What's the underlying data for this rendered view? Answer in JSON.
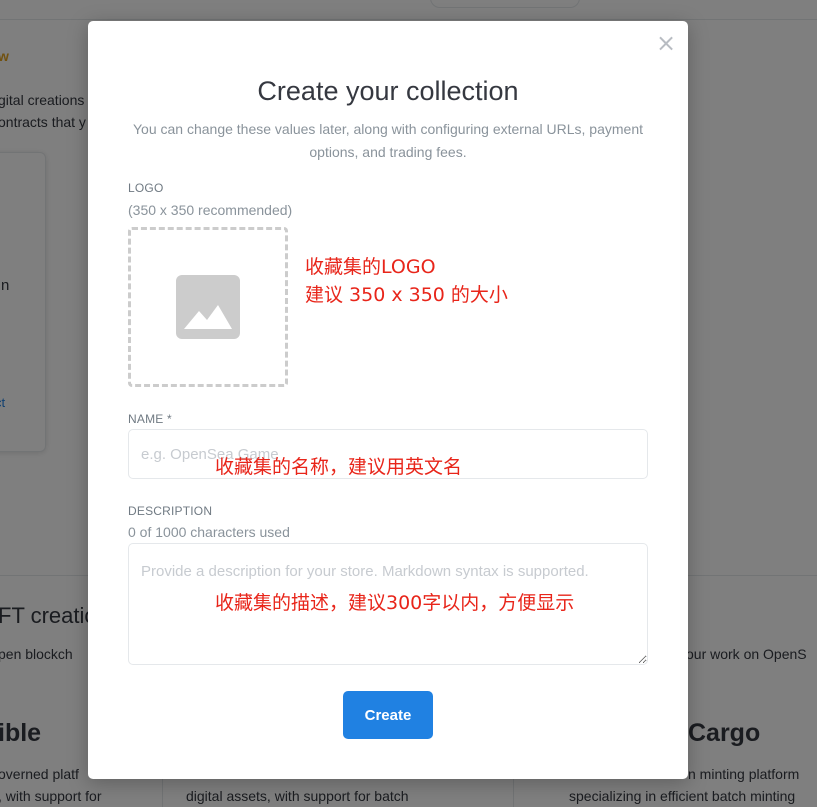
{
  "background": {
    "left_texts": {
      "line1": "w",
      "line2": "gital creations",
      "line3": "ontracts that y",
      "card_text1": "n",
      "card_link": "ct",
      "section_heading": "FT creatio",
      "section_sub": "pen blockch",
      "brand_left": "ible",
      "left_desc1": "overned platf",
      "left_desc2": ", with support for"
    },
    "middle_texts": {
      "desc": "digital assets, with support for batch"
    },
    "right_texts": {
      "sub": "our work on OpenS",
      "brand_right": "Cargo",
      "desc1": "n minting platform",
      "desc2": "specializing in efficient batch minting"
    }
  },
  "modal": {
    "close_symbol": "×",
    "title": "Create your collection",
    "subtitle": "You can change these values later, along with configuring external URLs, payment options, and trading fees.",
    "logo": {
      "label": "LOGO",
      "hint": "(350 x 350 recommended)",
      "icon": "image-placeholder-icon"
    },
    "name": {
      "label": "NAME *",
      "placeholder": "e.g. OpenSea Game"
    },
    "description": {
      "label": "DESCRIPTION",
      "counter": "0 of 1000 characters used",
      "placeholder": "Provide a description for your store. Markdown syntax is supported."
    },
    "create_label": "Create"
  },
  "annotations": {
    "logo_line1": "收藏集的LOGO",
    "logo_line2": "建议 350 x 350 的大小",
    "name_note": "收藏集的名称，建议用英文名",
    "desc_note": "收藏集的描述，建议300字以内，方便显示"
  },
  "colors": {
    "primary": "#2081e2",
    "annotation": "#e8251a",
    "overlay": "rgba(0,0,0,0.5)"
  }
}
